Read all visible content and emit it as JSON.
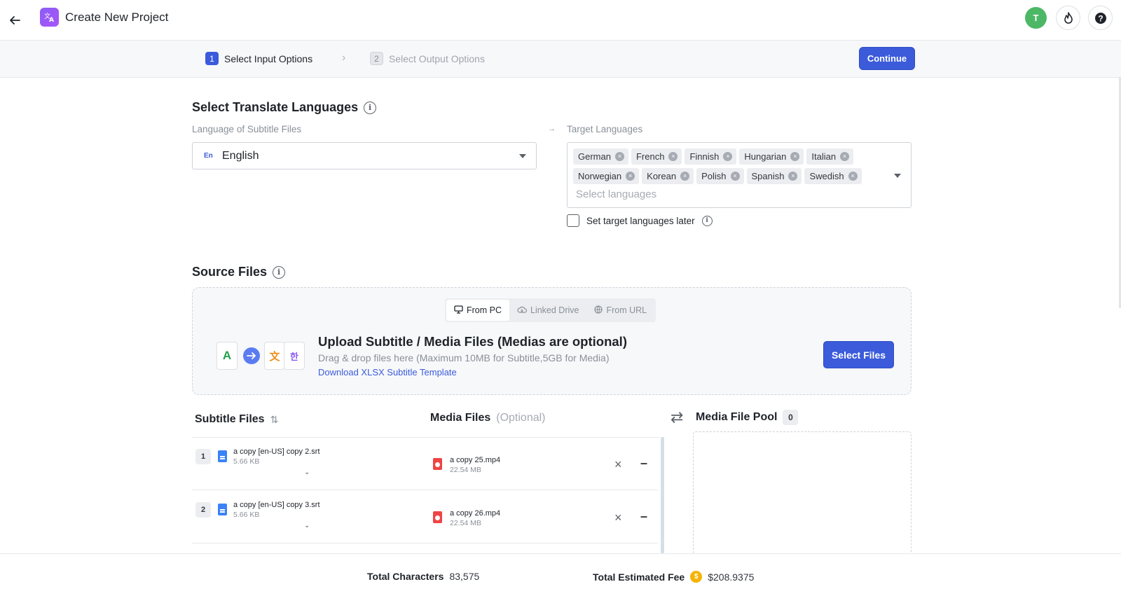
{
  "header": {
    "title": "Create New Project",
    "avatar_initial": "T"
  },
  "steps": [
    {
      "num": "1",
      "label": "Select Input Options"
    },
    {
      "num": "2",
      "label": "Select Output Options"
    }
  ],
  "continue_label": "Continue",
  "languages": {
    "title": "Select Translate Languages",
    "source_label": "Language of Subtitle Files",
    "source_code": "En",
    "source_value": "English",
    "target_label": "Target Languages",
    "targets": [
      "German",
      "French",
      "Finnish",
      "Hungarian",
      "Italian",
      "Norwegian",
      "Korean",
      "Polish",
      "Spanish",
      "Swedish"
    ],
    "target_placeholder": "Select languages",
    "set_later_label": "Set target languages later"
  },
  "source": {
    "title": "Source Files",
    "tabs": [
      "From PC",
      "Linked Drive",
      "From URL"
    ],
    "upload_title": "Upload Subtitle / Media Files (Medias are optional)",
    "upload_sub": "Drag & drop files here (Maximum 10MB for Subtitle,5GB for Media)",
    "template_link": "Download XLSX Subtitle Template",
    "select_files": "Select Files",
    "illus_letters": [
      "A",
      "文",
      "한"
    ]
  },
  "lists": {
    "subtitle_head": "Subtitle Files",
    "media_head": "Media Files",
    "media_optional": "(Optional)",
    "pool_head": "Media File Pool",
    "pool_count": "0"
  },
  "rows": [
    {
      "num": "1",
      "subtitle": "a copy [en-US] copy 2.srt",
      "subtitle_size": "5.66 KB",
      "media": "a copy 25.mp4",
      "media_size": "22.54 MB"
    },
    {
      "num": "2",
      "subtitle": "a copy [en-US] copy 3.srt",
      "subtitle_size": "5.66 KB",
      "media": "a copy 26.mp4",
      "media_size": "22.54 MB"
    }
  ],
  "footer": {
    "chars_label": "Total Characters",
    "chars_value": "83,575",
    "fee_label": "Total Estimated Fee",
    "fee_value": "$208.9375"
  },
  "colors": {
    "accent": "#3b5bdb",
    "avatar": "#4cb866",
    "coin": "#f5b301"
  }
}
